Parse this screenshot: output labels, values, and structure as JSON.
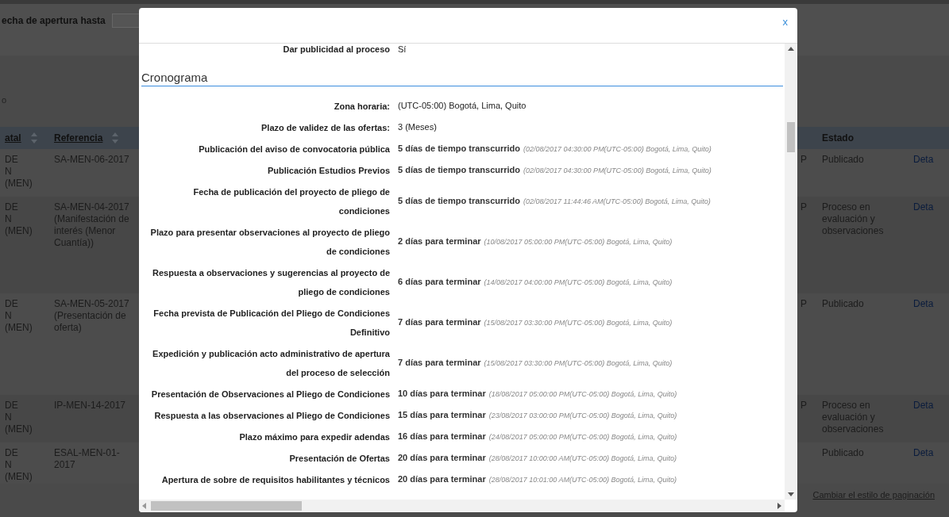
{
  "filter": {
    "label": "echa de apertura hasta"
  },
  "stray_text": "o",
  "table": {
    "columns": [
      {
        "label": "atal",
        "sortable": true
      },
      {
        "label": "Referencia",
        "sortable": true
      },
      {
        "label": "Estado",
        "sortable": false
      }
    ],
    "rows": [
      {
        "entity": [
          "DE",
          "N",
          "(MEN)"
        ],
        "reference": "SA-MEN-06-2017",
        "col_p": "P",
        "estado": "Publicado",
        "link": "Deta"
      },
      {
        "entity": [
          "DE",
          "N",
          "(MEN)"
        ],
        "reference": "SA-MEN-04-2017 (Manifestación de interés (Menor Cuantía))",
        "col_p": "P",
        "estado": "Proceso en evaluación y observaciones",
        "link": "Deta"
      },
      {
        "entity": [
          "DE",
          "N",
          "(MEN)"
        ],
        "reference": "SA-MEN-05-2017 (Presentación de oferta)",
        "col_p": "P",
        "estado": "Publicado",
        "link": "Deta"
      },
      {
        "entity": [
          "DE",
          "N",
          "(MEN)"
        ],
        "reference": "IP-MEN-14-2017",
        "col_p": "P",
        "estado": "Proceso en evaluación y observaciones",
        "link": "Deta"
      },
      {
        "entity": [
          "DE",
          "N",
          "(MEN)"
        ],
        "reference": "ESAL-MEN-01-2017",
        "estado": "Publicado",
        "link": "Deta"
      }
    ]
  },
  "pagination_link": "Cambiar el estilo de paginación",
  "modal": {
    "close": "x",
    "top_row": {
      "label": "Dar publicidad al proceso",
      "value": "Sí"
    },
    "section_title": "Cronograma",
    "rows": [
      {
        "label": "Zona horaria:",
        "kind": "plain",
        "value": "(UTC-05:00) Bogotá, Lima, Quito"
      },
      {
        "label": "Plazo de validez de las ofertas:",
        "kind": "plain",
        "value": "3 (Meses)"
      },
      {
        "label": "Publicación del aviso de convocatoria pública",
        "kind": "deadline",
        "value": "5 días de tiempo transcurrido",
        "note": "(02/08/2017 04:30:00 PM(UTC-05:00) Bogotá, Lima, Quito)"
      },
      {
        "label": "Publicación Estudios Previos",
        "kind": "deadline",
        "value": "5 días de tiempo transcurrido",
        "note": "(02/08/2017 04:30:00 PM(UTC-05:00) Bogotá, Lima, Quito)"
      },
      {
        "label": "Fecha de publicación del proyecto de pliego de condiciones",
        "kind": "deadline",
        "value": "5 días de tiempo transcurrido",
        "note": "(02/08/2017 11:44:46 AM(UTC-05:00) Bogotá, Lima, Quito)"
      },
      {
        "label": "Plazo para presentar observaciones al proyecto de pliego de condiciones",
        "kind": "deadline",
        "value": "2 días para terminar",
        "note": "(10/08/2017 05:00:00 PM(UTC-05:00) Bogotá, Lima, Quito)"
      },
      {
        "label": "Respuesta a observaciones y sugerencias al proyecto de pliego de condiciones",
        "kind": "deadline",
        "value": "6 días para terminar",
        "note": "(14/08/2017 04:00:00 PM(UTC-05:00) Bogotá, Lima, Quito)"
      },
      {
        "label": "Fecha prevista de Publicación del Pliego de Condiciones Definitivo",
        "kind": "deadline",
        "value": "7 días para terminar",
        "note": "(15/08/2017 03:30:00 PM(UTC-05:00) Bogotá, Lima, Quito)"
      },
      {
        "label": "Expedición y publicación acto administrativo de apertura del proceso de selección",
        "kind": "deadline",
        "value": "7 días para terminar",
        "note": "(15/08/2017 03:30:00 PM(UTC-05:00) Bogotá, Lima, Quito)"
      },
      {
        "label": "Presentación de Observaciones al Pliego de Condiciones",
        "kind": "deadline",
        "value": "10 días para terminar",
        "note": "(18/08/2017 05:00:00 PM(UTC-05:00) Bogotá, Lima, Quito)"
      },
      {
        "label": "Respuesta a las observaciones al Pliego de Condiciones",
        "kind": "deadline",
        "value": "15 días para terminar",
        "note": "(23/08/2017 03:00:00 PM(UTC-05:00) Bogotá, Lima, Quito)"
      },
      {
        "label": "Plazo máximo para expedir adendas",
        "kind": "deadline",
        "value": "16 días para terminar",
        "note": "(24/08/2017 05:00:00 PM(UTC-05:00) Bogotá, Lima, Quito)"
      },
      {
        "label": "Presentación de Ofertas",
        "kind": "deadline",
        "value": "20 días para terminar",
        "note": "(28/08/2017 10:00:00 AM(UTC-05:00) Bogotá, Lima, Quito)"
      },
      {
        "label": "Apertura de sobre de requisitos habilitantes y técnicos",
        "kind": "deadline",
        "value": "20 días para terminar",
        "note": "(28/08/2017 10:01:00 AM(UTC-05:00) Bogotá, Lima, Quito)"
      }
    ]
  }
}
